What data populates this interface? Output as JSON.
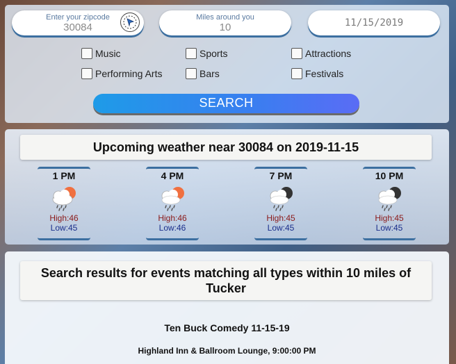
{
  "search": {
    "zip_label": "Enter your zipcode",
    "zip_value": "30084",
    "miles_label": "Miles around you",
    "miles_value": "10",
    "date_value": "11/15/2019",
    "categories": [
      {
        "label": "Music"
      },
      {
        "label": "Sports"
      },
      {
        "label": "Attractions"
      },
      {
        "label": "Performing Arts"
      },
      {
        "label": "Bars"
      },
      {
        "label": "Festivals"
      }
    ],
    "search_button": "SEARCH",
    "locate_icon": "location-arrow-icon"
  },
  "weather": {
    "title": "Upcoming weather near 30084 on 2019-11-15",
    "hours": [
      {
        "time": "1 PM",
        "high": "High:46",
        "low": "Low:45",
        "icon": "rain-cloud-sun-icon"
      },
      {
        "time": "4 PM",
        "high": "High:46",
        "low": "Low:46",
        "icon": "rain-cloud-sun-icon"
      },
      {
        "time": "7 PM",
        "high": "High:45",
        "low": "Low:45",
        "icon": "rain-cloud-moon-icon"
      },
      {
        "time": "10 PM",
        "high": "High:45",
        "low": "Low:45",
        "icon": "rain-cloud-moon-icon"
      }
    ]
  },
  "results": {
    "title": "Search results for events matching all types within 10 miles of Tucker",
    "events": [
      {
        "name": "Ten Buck Comedy 11-15-19",
        "venue": "Highland Inn & Ballroom Lounge, 9:00:00 PM"
      }
    ]
  },
  "colors": {
    "accent": "#3c6fa0",
    "search_button_start": "#1e9be8",
    "search_button_end": "#5a6cf5",
    "high_temp": "#8b1a1a",
    "low_temp": "#1a2e8b",
    "sun": "#f07040",
    "moon": "#333333"
  }
}
